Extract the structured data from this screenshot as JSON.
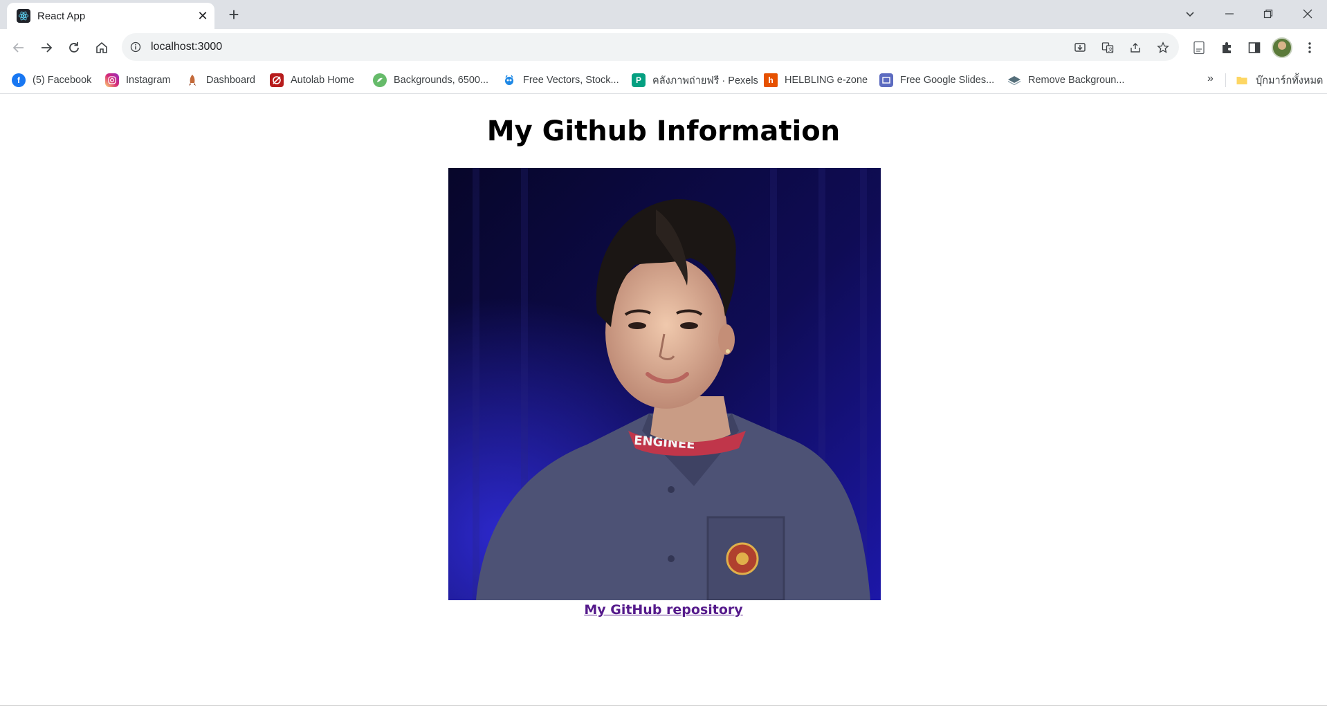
{
  "browser": {
    "tab": {
      "title": "React App",
      "favicon": "react-icon"
    },
    "address_bar": {
      "url": "localhost:3000"
    },
    "bookmarks": [
      {
        "label": "(5) Facebook",
        "icon": "facebook-icon",
        "color": "#1877f2"
      },
      {
        "label": "Instagram",
        "icon": "instagram-icon",
        "color": "#d62976"
      },
      {
        "label": "Dashboard",
        "icon": "rocket-icon",
        "color": "#b5651d"
      },
      {
        "label": "Autolab Home",
        "icon": "autolab-icon",
        "color": "#b71c1c"
      },
      {
        "label": "Backgrounds, 6500...",
        "icon": "backgrounds-icon",
        "color": "#4caf50"
      },
      {
        "label": "Free Vectors, Stock...",
        "icon": "vector-icon",
        "color": "#1e88e5"
      },
      {
        "label": "คลังภาพถ่ายฟรี · Pexels",
        "icon": "pexels-icon",
        "color": "#05a081"
      },
      {
        "label": "HELBLING e-zone",
        "icon": "helbling-icon",
        "color": "#e65100"
      },
      {
        "label": "Free Google Slides...",
        "icon": "slides-icon",
        "color": "#5c6bc0"
      },
      {
        "label": "Remove Backgroun...",
        "icon": "layers-icon",
        "color": "#455a64"
      }
    ],
    "bookmarks_overflow": "»",
    "all_bookmarks": {
      "label": "บุ๊กมาร์กทั้งหมด",
      "icon": "folder-icon",
      "color": "#fdd663"
    }
  },
  "page": {
    "heading": "My Github Information",
    "photo_alt": "profile-photo",
    "link_text": "My GitHub repository"
  }
}
